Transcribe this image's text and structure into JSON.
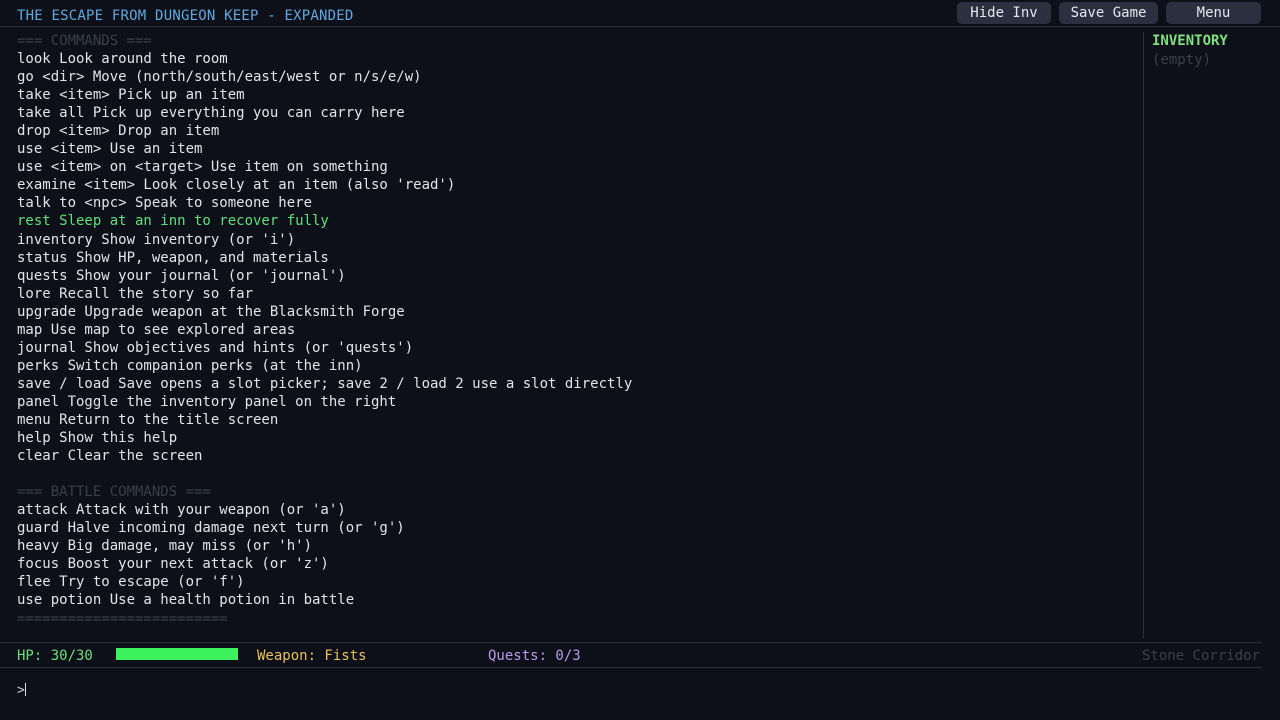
{
  "title": "THE ESCAPE FROM DUNGEON KEEP - EXPANDED",
  "buttons": {
    "hide_inv": "Hide Inv",
    "save_game": "Save Game",
    "menu": "Menu"
  },
  "log": [
    {
      "text": "=== COMMANDS ===",
      "style": "header"
    },
    {
      "text": "look Look around the room",
      "style": "normal"
    },
    {
      "text": "go <dir> Move (north/south/east/west or n/s/e/w)",
      "style": "normal"
    },
    {
      "text": "take <item> Pick up an item",
      "style": "normal"
    },
    {
      "text": "take all Pick up everything you can carry here",
      "style": "normal"
    },
    {
      "text": "drop <item> Drop an item",
      "style": "normal"
    },
    {
      "text": "use <item> Use an item",
      "style": "normal"
    },
    {
      "text": "use <item> on <target> Use item on something",
      "style": "normal"
    },
    {
      "text": "examine <item> Look closely at an item (also 'read')",
      "style": "normal"
    },
    {
      "text": "talk to <npc> Speak to someone here",
      "style": "normal"
    },
    {
      "text": "rest Sleep at an inn to recover fully",
      "style": "green"
    },
    {
      "text": "inventory Show inventory (or 'i')",
      "style": "normal"
    },
    {
      "text": "status Show HP, weapon, and materials",
      "style": "normal"
    },
    {
      "text": "quests Show your journal (or 'journal')",
      "style": "normal"
    },
    {
      "text": "lore Recall the story so far",
      "style": "normal"
    },
    {
      "text": "upgrade Upgrade weapon at the Blacksmith Forge",
      "style": "normal"
    },
    {
      "text": "map Use map to see explored areas",
      "style": "normal"
    },
    {
      "text": "journal Show objectives and hints (or 'quests')",
      "style": "normal"
    },
    {
      "text": "perks Switch companion perks (at the inn)",
      "style": "normal"
    },
    {
      "text": "save / load Save opens a slot picker; save 2 / load 2 use a slot directly",
      "style": "normal"
    },
    {
      "text": "panel Toggle the inventory panel on the right",
      "style": "normal"
    },
    {
      "text": "menu Return to the title screen",
      "style": "normal"
    },
    {
      "text": "help Show this help",
      "style": "normal"
    },
    {
      "text": "clear Clear the screen",
      "style": "normal"
    },
    {
      "text": "",
      "style": "normal"
    },
    {
      "text": "=== BATTLE COMMANDS ===",
      "style": "header"
    },
    {
      "text": "attack Attack with your weapon (or 'a')",
      "style": "normal"
    },
    {
      "text": "guard Halve incoming damage next turn (or 'g')",
      "style": "normal"
    },
    {
      "text": "heavy Big damage, may miss (or 'h')",
      "style": "normal"
    },
    {
      "text": "focus Boost your next attack (or 'z')",
      "style": "normal"
    },
    {
      "text": "flee Try to escape (or 'f')",
      "style": "normal"
    },
    {
      "text": "use potion Use a health potion in battle",
      "style": "normal"
    },
    {
      "text": "=========================",
      "style": "header"
    }
  ],
  "inventory": {
    "title": "INVENTORY",
    "empty_text": "(empty)"
  },
  "status": {
    "hp_text": "HP: 30/30",
    "hp_fraction": 1.0,
    "weapon_text": "Weapon: Fists",
    "quests_text": "Quests: 0/3",
    "location": "Stone Corridor"
  },
  "prompt": ">",
  "colors": {
    "accent_title": "#5fa8e0",
    "hp_green": "#3df25e",
    "weapon_gold": "#e7c25a",
    "quests_purple": "#b79be8",
    "highlight_green": "#5fe07a"
  }
}
